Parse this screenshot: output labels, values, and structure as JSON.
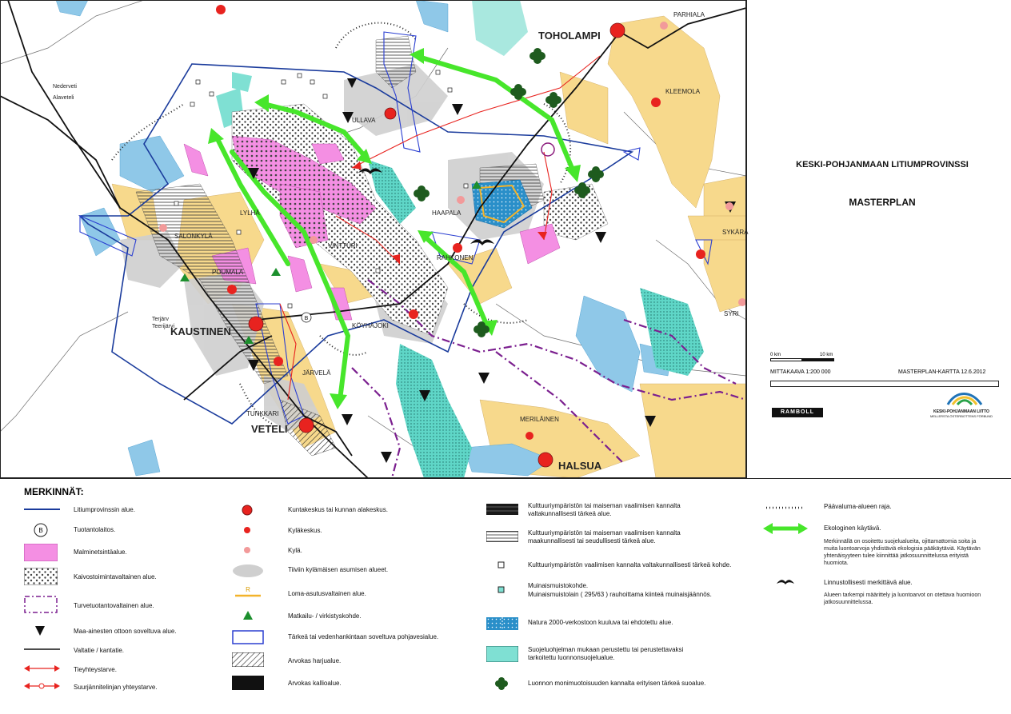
{
  "map": {
    "places": {
      "toholampi": "TOHOLAMPI",
      "parhiala": "PARHIALA",
      "kleemola": "KLEEMOLA",
      "ullava": "ULLAVA",
      "haapala": "HAAPALA",
      "rahkonen": "RAHKONEN",
      "vintturi": "VINTTURI",
      "lylha": "LYLHÄ",
      "salonkyla": "SALONKYLÄ",
      "poumala": "POUMALA",
      "kaustinen": "KAUSTINEN",
      "koyhajoki": "KÖYHÄJOKI",
      "jarvela": "JÄRVELÄ",
      "tunkkari": "TUNKKARI",
      "veteli": "VETELI",
      "merilainen": "MERILÄINEN",
      "halsua": "HALSUA",
      "sykara": "SYKÄRÄ",
      "syri": "SYRI",
      "nederveti": "Nederveti",
      "alaveteli": "Alaveteli",
      "terjarv": "Terjärv",
      "teerijarvi": "Teerijärvi"
    }
  },
  "sidebar": {
    "title": "KESKI-POHJANMAAN LITIUMPROVINSSI",
    "subtitle": "MASTERPLAN",
    "scale_0": "0 km",
    "scale_10": "10 km",
    "scale_text": "MITTAKAAVA 1:200 000",
    "map_id": "MASTERPLAN-KARTTA 12.6.2012",
    "logo_left": "RAMBOLL",
    "logo_right_1": "KESKI-POHJANMAAN LIITTO",
    "logo_right_2": "MELLERSTA ÖSTERBOTTENS FÖRBUND"
  },
  "legend": {
    "heading": "MERKINNÄT:",
    "col1": [
      "Litiumprovinssin alue.",
      "Tuotantolaitos.",
      "Malminetsintäalue.",
      "Kaivostoimintavaltainen alue.",
      "Turvetuotantovaltainen alue.",
      "Maa-ainesten ottoon soveltuva alue.",
      "Valtatie / kantatie.",
      "Tieyhteystarve.",
      "Suurjännitelinjan yhteystarve."
    ],
    "production_symbol": "B",
    "col2": [
      "Kuntakeskus tai kunnan alakeskus.",
      "Kyläkeskus.",
      "Kylä.",
      "Tiiviin kylämäisen asumisen alueet.",
      "Loma-asutusvaltainen alue.",
      "Matkailu- / virkistyskohde.",
      "Tärkeä tai vedenhankintaan soveltuva pohjavesialue.",
      "Arvokas harjualue.",
      "Arvokas kallioalue."
    ],
    "resort_symbol": "R",
    "col3": [
      "Kulttuuriympäristön tai maiseman vaalimisen kannalta valtakunnallisesti tärkeä alue.",
      "Kulttuuriympäristön tai maiseman vaalimisen kannalta maakunnallisesti tai seudullisesti tärkeä alue.",
      "Kulttuuriympäristön vaalimisen kannalta valtakunnallisesti tärkeä kohde.",
      "Muinaismuistokohde.",
      "Muinaismuistolain ( 295/63 ) rauhoittama kiinteä muinaisjäännös.",
      "Natura 2000-verkostoon kuuluva tai ehdotettu alue.",
      "Suojeluohjelman mukaan perustettu tai perustettavaksi tarkoitettu luonnonsuojelualue.",
      "Luonnon monimuotoisuuden kannalta erityisen tärkeä suoalue."
    ],
    "col4": {
      "boundary": "Päävaluma-alueen raja.",
      "corridor": "Ekologinen käytävä.",
      "corridor_note": "Merkinnällä on osoitettu suojelualueita, ojittamattomia soita ja muita luontoarvoja yhdistäviä ekologisia pääkäytäviä. Käytävän yhtenäisyyteen tulee kiinnittää jatkosuunnittelussa erityistä huomiota.",
      "birds": "Linnustollisesti merkittävä alue.",
      "birds_note": "Alueen tarkempi määrittely ja luontoarvot on otettava huomioon jatkosuunnittelussa."
    }
  }
}
